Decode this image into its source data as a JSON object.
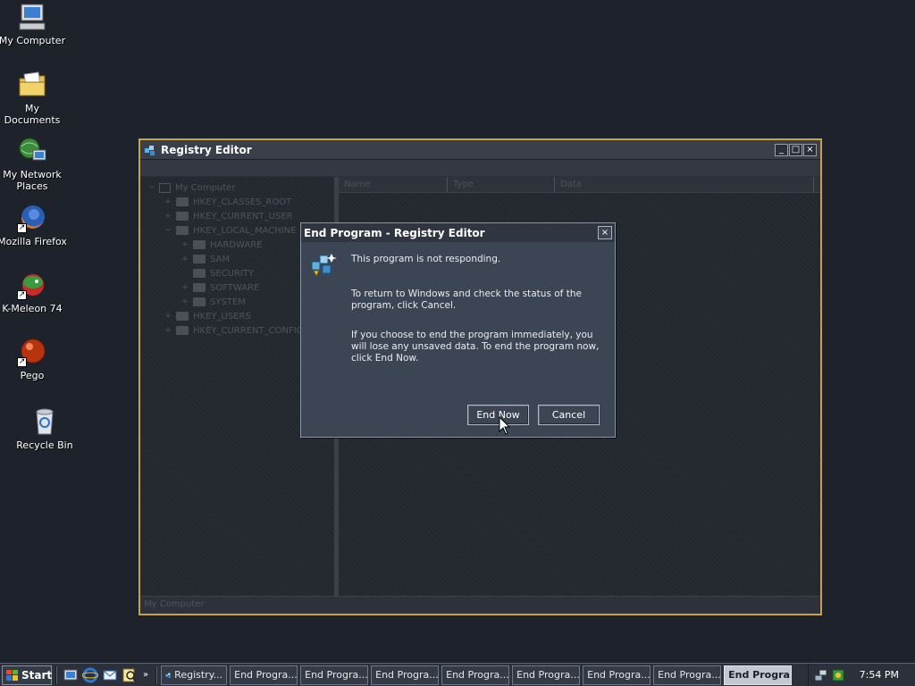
{
  "desktop": {
    "icons": [
      {
        "label": "My Computer",
        "icon": "computer-icon"
      },
      {
        "label": "My Documents",
        "icon": "documents-folder-icon"
      },
      {
        "label": "My Network Places",
        "icon": "network-places-icon"
      },
      {
        "label": "Mozilla Firefox",
        "icon": "firefox-icon"
      },
      {
        "label": "K-Meleon 74",
        "icon": "k-meleon-icon"
      },
      {
        "label": "Pego",
        "icon": "pego-icon"
      },
      {
        "label": "Recycle Bin",
        "icon": "recycle-bin-icon"
      }
    ]
  },
  "regedit": {
    "title": "Registry Editor",
    "columns": [
      "Name",
      "Type",
      "Data"
    ],
    "tree": [
      {
        "label": "My Computer",
        "expander": "−",
        "depth": 0,
        "kind": "computer"
      },
      {
        "label": "HKEY_CLASSES_ROOT",
        "expander": "+",
        "depth": 1,
        "kind": "folder"
      },
      {
        "label": "HKEY_CURRENT_USER",
        "expander": "+",
        "depth": 1,
        "kind": "folder"
      },
      {
        "label": "HKEY_LOCAL_MACHINE",
        "expander": "−",
        "depth": 1,
        "kind": "folder"
      },
      {
        "label": "HARDWARE",
        "expander": "+",
        "depth": 2,
        "kind": "folder"
      },
      {
        "label": "SAM",
        "expander": "+",
        "depth": 2,
        "kind": "folder"
      },
      {
        "label": "SECURITY",
        "expander": "",
        "depth": 2,
        "kind": "folder"
      },
      {
        "label": "SOFTWARE",
        "expander": "+",
        "depth": 2,
        "kind": "folder"
      },
      {
        "label": "SYSTEM",
        "expander": "+",
        "depth": 2,
        "kind": "folder"
      },
      {
        "label": "HKEY_USERS",
        "expander": "+",
        "depth": 1,
        "kind": "folder"
      },
      {
        "label": "HKEY_CURRENT_CONFIG",
        "expander": "+",
        "depth": 1,
        "kind": "folder"
      }
    ],
    "status": "My Computer"
  },
  "dialog": {
    "title": "End Program - Registry Editor",
    "line1": "This program is not responding.",
    "line2": "To return to Windows and check the status of the program, click Cancel.",
    "line3": "If you choose to end the program immediately, you will lose any unsaved data. To end the program now, click End Now.",
    "end_now_label": "End Now",
    "cancel_label": "Cancel"
  },
  "taskbar": {
    "start_label": "Start",
    "chevron": "»",
    "quick_launch": [
      "show-desktop-icon",
      "internet-explorer-icon",
      "outlook-icon",
      "search-icon"
    ],
    "tasks": [
      {
        "label": "Registry...",
        "active": false
      },
      {
        "label": "End Progra...",
        "active": false
      },
      {
        "label": "End Progra...",
        "active": false
      },
      {
        "label": "End Progra...",
        "active": false
      },
      {
        "label": "End Progra...",
        "active": false
      },
      {
        "label": "End Progra...",
        "active": false
      },
      {
        "label": "End Progra...",
        "active": false
      },
      {
        "label": "End Progra...",
        "active": false
      },
      {
        "label": "End Progra...",
        "active": true
      }
    ],
    "clock": "7:54 PM"
  },
  "colors": {
    "desktop_bg": "#1d222b",
    "window_border": "#c8a24a",
    "dialog_bg": "#3c4554"
  }
}
